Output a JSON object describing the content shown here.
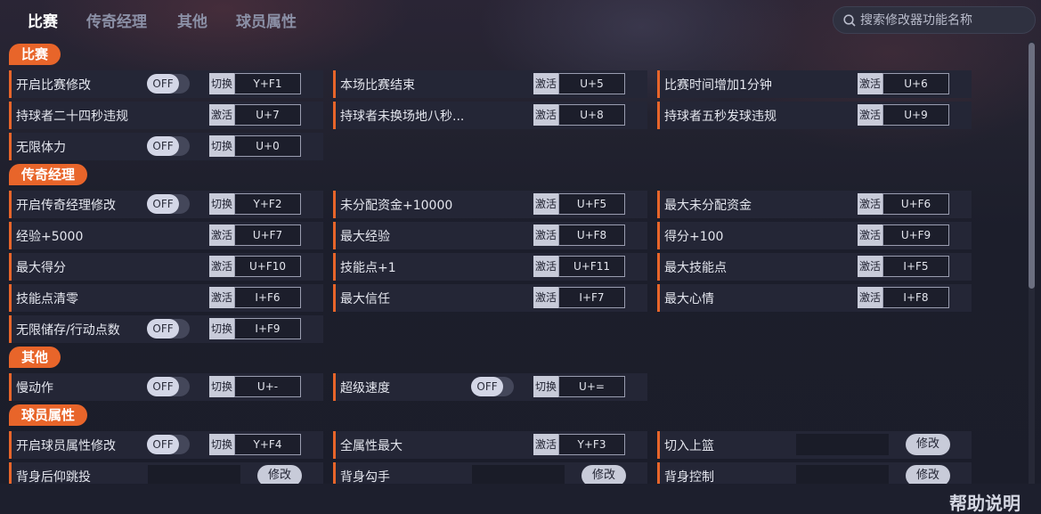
{
  "tabs": [
    "比赛",
    "传奇经理",
    "其他",
    "球员属性"
  ],
  "search": {
    "placeholder": "搜索修改器功能名称",
    "icon": "search-icon"
  },
  "help_label": "帮助说明",
  "colors": {
    "accent": "#e8652a",
    "background": "#1d1f2e",
    "row": "#242636",
    "text": "#e4e6ee"
  },
  "labels": {
    "toggle_off": "OFF",
    "switch": "切换",
    "activate": "激活",
    "modify": "修改"
  },
  "sections": [
    {
      "title": "比赛",
      "rows": [
        [
          {
            "type": "toggle",
            "label": "开启比赛修改",
            "state": "OFF",
            "key": "Y+F1"
          },
          {
            "type": "activate",
            "label": "本场比赛结束",
            "key": "U+5"
          },
          {
            "type": "activate",
            "label": "比赛时间增加1分钟",
            "key": "U+6"
          }
        ],
        [
          {
            "type": "activate",
            "label": "持球者二十四秒违规",
            "key": "U+7"
          },
          {
            "type": "activate",
            "label": "持球者未换场地八秒...",
            "key": "U+8"
          },
          {
            "type": "activate",
            "label": "持球者五秒发球违规",
            "key": "U+9"
          }
        ],
        [
          {
            "type": "toggle",
            "label": "无限体力",
            "state": "OFF",
            "key": "U+0"
          }
        ]
      ]
    },
    {
      "title": "传奇经理",
      "rows": [
        [
          {
            "type": "toggle",
            "label": "开启传奇经理修改",
            "state": "OFF",
            "key": "Y+F2"
          },
          {
            "type": "activate",
            "label": "未分配资金+10000",
            "key": "U+F5"
          },
          {
            "type": "activate",
            "label": "最大未分配资金",
            "key": "U+F6"
          }
        ],
        [
          {
            "type": "activate",
            "label": "经验+5000",
            "key": "U+F7"
          },
          {
            "type": "activate",
            "label": "最大经验",
            "key": "U+F8"
          },
          {
            "type": "activate",
            "label": "得分+100",
            "key": "U+F9"
          }
        ],
        [
          {
            "type": "activate",
            "label": "最大得分",
            "key": "U+F10"
          },
          {
            "type": "activate",
            "label": "技能点+1",
            "key": "U+F11"
          },
          {
            "type": "activate",
            "label": "最大技能点",
            "key": "I+F5"
          }
        ],
        [
          {
            "type": "activate",
            "label": "技能点清零",
            "key": "I+F6"
          },
          {
            "type": "activate",
            "label": "最大信任",
            "key": "I+F7"
          },
          {
            "type": "activate",
            "label": "最大心情",
            "key": "I+F8"
          }
        ],
        [
          {
            "type": "toggle",
            "label": "无限储存/行动点数",
            "state": "OFF",
            "key": "I+F9"
          }
        ]
      ]
    },
    {
      "title": "其他",
      "rows": [
        [
          {
            "type": "toggle",
            "label": "慢动作",
            "state": "OFF",
            "key": "U+-"
          },
          {
            "type": "toggle",
            "label": "超级速度",
            "state": "OFF",
            "key": "U+="
          }
        ]
      ]
    },
    {
      "title": "球员属性",
      "rows": [
        [
          {
            "type": "toggle",
            "label": "开启球员属性修改",
            "state": "OFF",
            "key": "Y+F4"
          },
          {
            "type": "activate",
            "label": "全属性最大",
            "key": "Y+F3"
          },
          {
            "type": "modify",
            "label": "切入上篮",
            "value": ""
          }
        ],
        [
          {
            "type": "modify",
            "label": "背身后仰跳投",
            "value": ""
          },
          {
            "type": "modify",
            "label": "背身勾手",
            "value": ""
          },
          {
            "type": "modify",
            "label": "背身控制",
            "value": ""
          }
        ]
      ]
    }
  ]
}
